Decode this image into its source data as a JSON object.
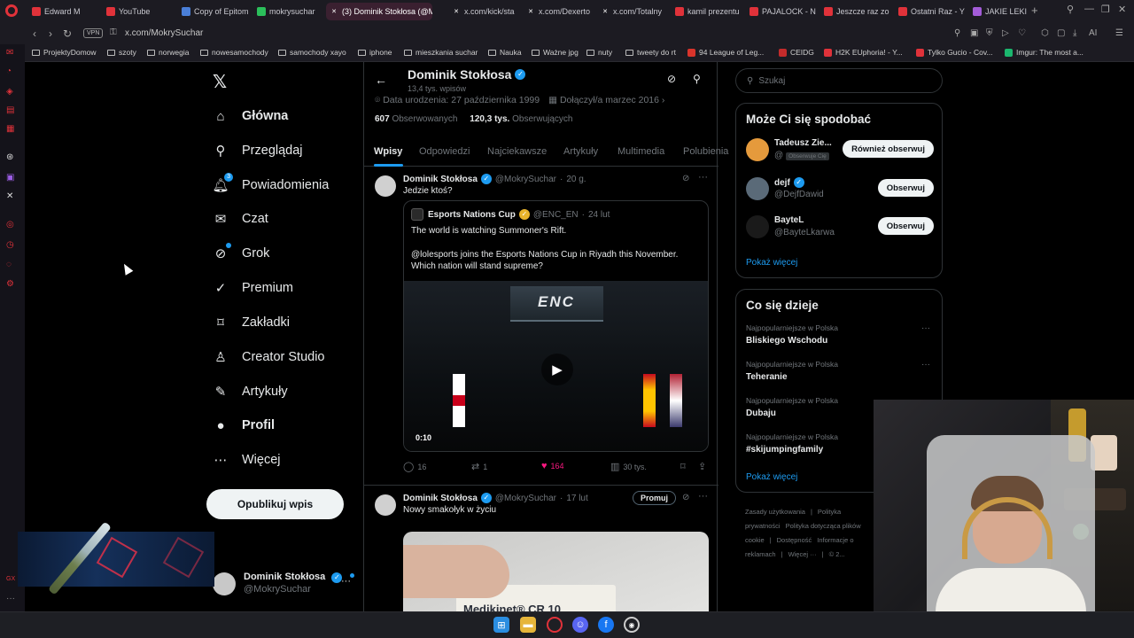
{
  "browser": {
    "tabs": [
      {
        "label": "Edward M",
        "color": "#e0323a"
      },
      {
        "label": "YouTube",
        "color": "#e0323a"
      },
      {
        "label": "Copy of Epitom",
        "color": "#4a7fd8"
      },
      {
        "label": "mokrysuchar",
        "color": "#2bbf5b"
      },
      {
        "label": "(3) Dominik Stokłosa (@M",
        "color": "#ffffff"
      },
      {
        "label": "x.com/kick/sta",
        "color": "#ffffff"
      },
      {
        "label": "x.com/Dexerto",
        "color": "#ffffff"
      },
      {
        "label": "x.com/Totalny",
        "color": "#ffffff"
      },
      {
        "label": "kamil prezentu",
        "color": "#e0323a"
      },
      {
        "label": "PAJALOCK - N",
        "color": "#e0323a"
      },
      {
        "label": "Jeszcze raz zo",
        "color": "#e0323a"
      },
      {
        "label": "Ostatni Raz - Y",
        "color": "#e0323a"
      },
      {
        "label": "JAKIE LEKI - T",
        "color": "#a35cd8"
      }
    ],
    "vpn_label": "VPN",
    "url": "x.com/MokrySuchar",
    "ai_label": "AI",
    "bookmarks": [
      {
        "label": "ProjektyDomow",
        "color": ""
      },
      {
        "label": "szoty",
        "color": ""
      },
      {
        "label": "norwegia",
        "color": ""
      },
      {
        "label": "nowesamochody",
        "color": ""
      },
      {
        "label": "samochody xayo",
        "color": ""
      },
      {
        "label": "iphone",
        "color": ""
      },
      {
        "label": "mieszkania suchar",
        "color": ""
      },
      {
        "label": "Nauka",
        "color": ""
      },
      {
        "label": "Ważne jpg",
        "color": ""
      },
      {
        "label": "nuty",
        "color": ""
      },
      {
        "label": "tweety do rt",
        "color": ""
      },
      {
        "label": "94 League of Leg...",
        "color": "#d9342b"
      },
      {
        "label": "CEIDG",
        "color": "#c42b2b"
      },
      {
        "label": "H2K EUphoria! - Y...",
        "color": "#e0323a"
      },
      {
        "label": "Tylko Gucio - Cov...",
        "color": "#e0323a"
      },
      {
        "label": "Imgur: The most a...",
        "color": "#1bb76e"
      }
    ]
  },
  "nav": {
    "items": [
      {
        "label": "Główna",
        "icon": "home-icon",
        "glyph": "⌂",
        "bold": true
      },
      {
        "label": "Przeglądaj",
        "icon": "search-icon",
        "glyph": "⚲",
        "bold": false
      },
      {
        "label": "Powiadomienia",
        "icon": "bell-icon",
        "glyph": "🔔︎",
        "bold": false,
        "badge": "3"
      },
      {
        "label": "Czat",
        "icon": "mail-icon",
        "glyph": "✉",
        "bold": false
      },
      {
        "label": "Grok",
        "icon": "grok-icon",
        "glyph": "⊘",
        "bold": false,
        "dot": true
      },
      {
        "label": "Premium",
        "icon": "premium-icon",
        "glyph": "✓",
        "bold": false
      },
      {
        "label": "Zakładki",
        "icon": "bookmark-icon",
        "glyph": "⌑",
        "bold": false
      },
      {
        "label": "Creator Studio",
        "icon": "flask-icon",
        "glyph": "♙",
        "bold": false
      },
      {
        "label": "Artykuły",
        "icon": "article-icon",
        "glyph": "✎",
        "bold": false
      },
      {
        "label": "Profil",
        "icon": "profile-icon",
        "glyph": "●",
        "bold": true
      },
      {
        "label": "Więcej",
        "icon": "more-icon",
        "glyph": "⋯",
        "bold": false
      }
    ],
    "post_button": "Opublikuj wpis",
    "account": {
      "name": "Dominik Stokłosa",
      "handle": "@MokrySuchar",
      "more": "···"
    }
  },
  "profile": {
    "name": "Dominik Stokłosa",
    "post_count": "13,4 tys. wpisów",
    "birth": "Data urodzenia: 27 października 1999",
    "joined": "Dołączył/a marzec 2016",
    "following_count": "607",
    "following_label": "Obserwowanych",
    "followers_count": "120,3 tys.",
    "followers_label": "Obserwujących",
    "tabs": [
      "Wpisy",
      "Odpowiedzi",
      "Najciekawsze",
      "Artykuły",
      "Multimedia",
      "Polubienia"
    ]
  },
  "posts": [
    {
      "author": "Dominik Stokłosa",
      "handle": "@MokrySuchar",
      "time": "20 g.",
      "text": "Jedzie ktoś?",
      "quote": {
        "author": "Esports Nations Cup",
        "handle": "@ENC_EN",
        "time": "24 lut",
        "line1": "The world is watching Summoner's Rift.",
        "line2": "@lolesports joins the Esports Nations Cup in Riyadh this November.",
        "line3": "Which nation will stand supreme?",
        "video_logo": "ENC",
        "video_time": "0:10"
      },
      "stats": {
        "replies": "16",
        "reposts": "1",
        "likes": "164",
        "views": "30 tys."
      }
    },
    {
      "author": "Dominik Stokłosa",
      "handle": "@MokrySuchar",
      "time": "17 lut",
      "text": "Nowy smakołyk w życiu",
      "promote": "Promuj",
      "photo_text": "Medikinet® CR 10"
    }
  ],
  "right": {
    "search_placeholder": "Szukaj",
    "wtf_title": "Może Ci się spodobać",
    "wtf": [
      {
        "name": "Tadeusz Zie...",
        "handle": "@",
        "follows_you": "Obserwuje Cię",
        "button": "Również obserwuj",
        "color": "#e59a3c",
        "verified": false
      },
      {
        "name": "dejf",
        "handle": "@DejfDawid",
        "follows_you": "",
        "button": "Obserwuj",
        "color": "#5a6a78",
        "verified": true
      },
      {
        "name": "BayteL",
        "handle": "@BayteLkarwa",
        "follows_you": "",
        "button": "Obserwuj",
        "color": "#1a1a1a",
        "verified": false
      }
    ],
    "show_more": "Pokaż więcej",
    "trends_title": "Co się dzieje",
    "trends": [
      {
        "context": "Najpopularniejsze w Polska",
        "name": "Bliskiego Wschodu",
        "more": "···"
      },
      {
        "context": "Najpopularniejsze w Polska",
        "name": "Teheranie",
        "more": "···"
      },
      {
        "context": "Najpopularniejsze w Polska",
        "name": "Dubaju",
        "more": ""
      },
      {
        "context": "Najpopularniejsze w Polska",
        "name": "#skijumpingfamily",
        "more": ""
      }
    ],
    "footer": [
      "Zasady użytkowania",
      "|",
      "Polityka prywatności",
      "Polityka dotycząca plików cookie",
      "|",
      "Dostępność",
      "Informacje o reklamach",
      "|",
      "Więcej ···",
      "|",
      "© 2..."
    ]
  }
}
